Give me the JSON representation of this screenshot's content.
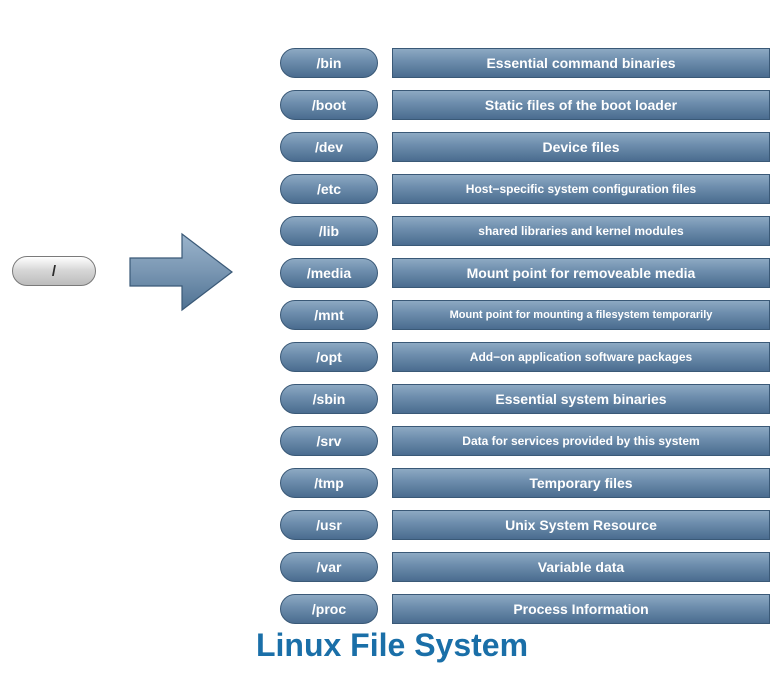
{
  "root": {
    "label": "/"
  },
  "title": "Linux File System",
  "rows": [
    {
      "dir": "/bin",
      "desc": "Essential command binaries",
      "size": ""
    },
    {
      "dir": "/boot",
      "desc": "Static files of the boot loader",
      "size": ""
    },
    {
      "dir": "/dev",
      "desc": "Device files",
      "size": ""
    },
    {
      "dir": "/etc",
      "desc": "Host−specific system configuration files",
      "size": "small"
    },
    {
      "dir": "/lib",
      "desc": "shared libraries and kernel modules",
      "size": "small"
    },
    {
      "dir": "/media",
      "desc": "Mount point for removeable media",
      "size": ""
    },
    {
      "dir": "/mnt",
      "desc": "Mount point for mounting a filesystem temporarily",
      "size": "xsmall"
    },
    {
      "dir": "/opt",
      "desc": "Add−on application software packages",
      "size": "small"
    },
    {
      "dir": "/sbin",
      "desc": "Essential system binaries",
      "size": ""
    },
    {
      "dir": "/srv",
      "desc": "Data for services provided by this system",
      "size": "small"
    },
    {
      "dir": "/tmp",
      "desc": "Temporary files",
      "size": ""
    },
    {
      "dir": "/usr",
      "desc": "Unix System Resource",
      "size": ""
    },
    {
      "dir": "/var",
      "desc": "Variable data",
      "size": ""
    },
    {
      "dir": "/proc",
      "desc": "Process Information",
      "size": ""
    }
  ],
  "colors": {
    "accent": "#1a6fa8",
    "pillGradientTop": "#8da9c3",
    "pillGradientBottom": "#4a6c8f"
  }
}
